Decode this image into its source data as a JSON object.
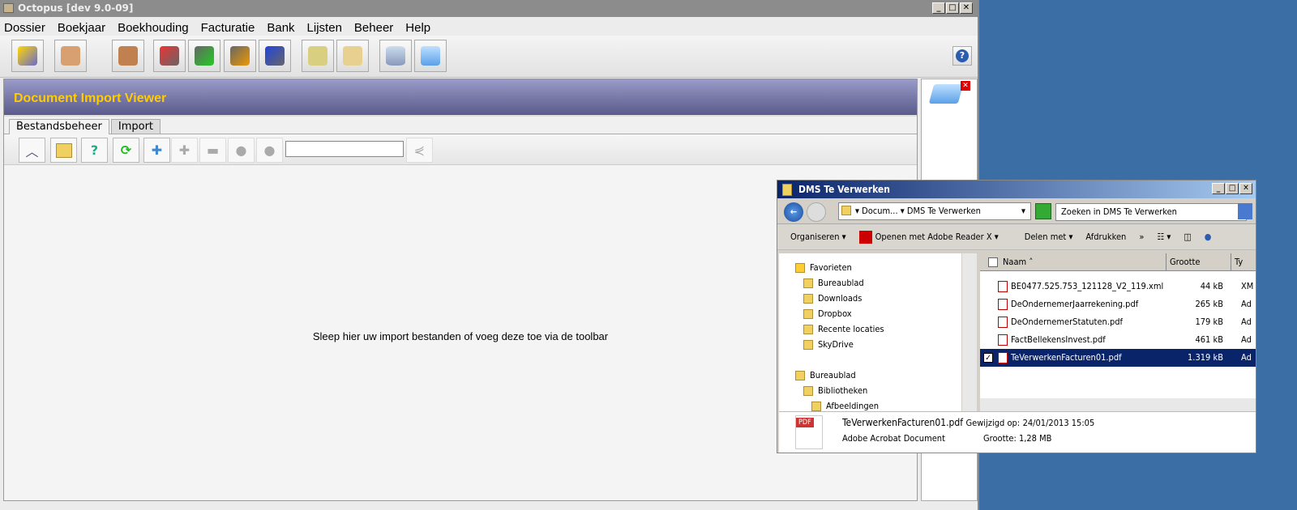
{
  "app": {
    "title": "Octopus [dev 9.0-09]",
    "menu": [
      "Dossier",
      "Boekjaar",
      "Boekhouding",
      "Facturatie",
      "Bank",
      "Lijsten",
      "Beheer",
      "Help"
    ],
    "toolbar_icons": [
      "new-dossier-icon",
      "cabinet-icon",
      "card-box-icon",
      "journal-import-icon",
      "journal-export-icon",
      "journal-dollar-icon",
      "journal-transfer-icon",
      "edit-document-icon",
      "documents-folder-icon",
      "database-icon",
      "tray-icon"
    ],
    "help_icon": "?"
  },
  "viewer": {
    "title": "Document Import Viewer",
    "tabs": [
      "Bestandsbeheer",
      "Import"
    ],
    "drop_text": "Sleep hier uw import bestanden of voeg deze toe via de toolbar",
    "filter_value": ""
  },
  "explorer": {
    "title": "DMS Te Verwerken",
    "breadcrumb": [
      "Docum...",
      "DMS Te Verwerken"
    ],
    "search_placeholder": "Zoeken in DMS Te Verwerken",
    "commands": [
      "Organiseren ▾",
      "Openen met Adobe Reader X ▾",
      "Delen met ▾",
      "Afdrukken",
      "»"
    ],
    "tree": [
      {
        "label": "Favorieten",
        "indent": 0
      },
      {
        "label": "Bureaublad",
        "indent": 1
      },
      {
        "label": "Downloads",
        "indent": 1
      },
      {
        "label": "Dropbox",
        "indent": 1
      },
      {
        "label": "Recente locaties",
        "indent": 1
      },
      {
        "label": "SkyDrive",
        "indent": 1
      },
      {
        "label": "",
        "indent": 0
      },
      {
        "label": "Bureaublad",
        "indent": 0
      },
      {
        "label": "Bibliotheken",
        "indent": 1
      },
      {
        "label": "Afbeeldingen",
        "indent": 2
      }
    ],
    "columns": [
      "Naam",
      "Grootte",
      "Ty"
    ],
    "files": [
      {
        "name": "BE0477.525.753_121128_V2_119.xml",
        "size": "44 kB",
        "type": "XM",
        "selected": false
      },
      {
        "name": "DeOndernemerJaarrekening.pdf",
        "size": "265 kB",
        "type": "Ad",
        "selected": false
      },
      {
        "name": "DeOndernemerStatuten.pdf",
        "size": "179 kB",
        "type": "Ad",
        "selected": false
      },
      {
        "name": "FactBellekensInvest.pdf",
        "size": "461 kB",
        "type": "Ad",
        "selected": false
      },
      {
        "name": "TeVerwerkenFacturen01.pdf",
        "size": "1.319 kB",
        "type": "Ad",
        "selected": true
      }
    ],
    "details": {
      "name": "TeVerwerkenFacturen01.pdf",
      "modified_label": "Gewijzigd op:",
      "modified": "24/01/2013 15:05",
      "kind": "Adobe Acrobat Document",
      "size_label": "Grootte:",
      "size": "1,28 MB",
      "badge": "PDF"
    }
  }
}
